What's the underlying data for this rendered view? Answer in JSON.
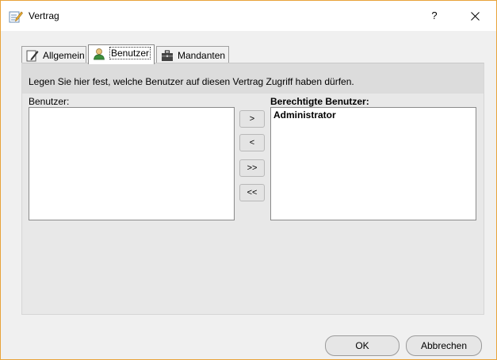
{
  "window": {
    "title": "Vertrag",
    "help_label": "?",
    "accent_color": "#e8a33a"
  },
  "tabs": [
    {
      "label": "Allgemein",
      "icon": "pencil-note-icon"
    },
    {
      "label": "Benutzer",
      "icon": "user-icon",
      "active": true
    },
    {
      "label": "Mandanten",
      "icon": "briefcase-icon"
    }
  ],
  "panel": {
    "info_text": "Legen Sie hier fest, welche Benutzer auf diesen Vertrag Zugriff haben dürfen.",
    "available_label": "Benutzer:",
    "authorized_label": "Berechtigte Benutzer:",
    "available_users": [],
    "authorized_users": [
      "Administrator"
    ]
  },
  "move_buttons": {
    "add": ">",
    "remove": "<",
    "add_all": ">>",
    "remove_all": "<<"
  },
  "footer": {
    "ok_label": "OK",
    "cancel_label": "Abbrechen"
  }
}
